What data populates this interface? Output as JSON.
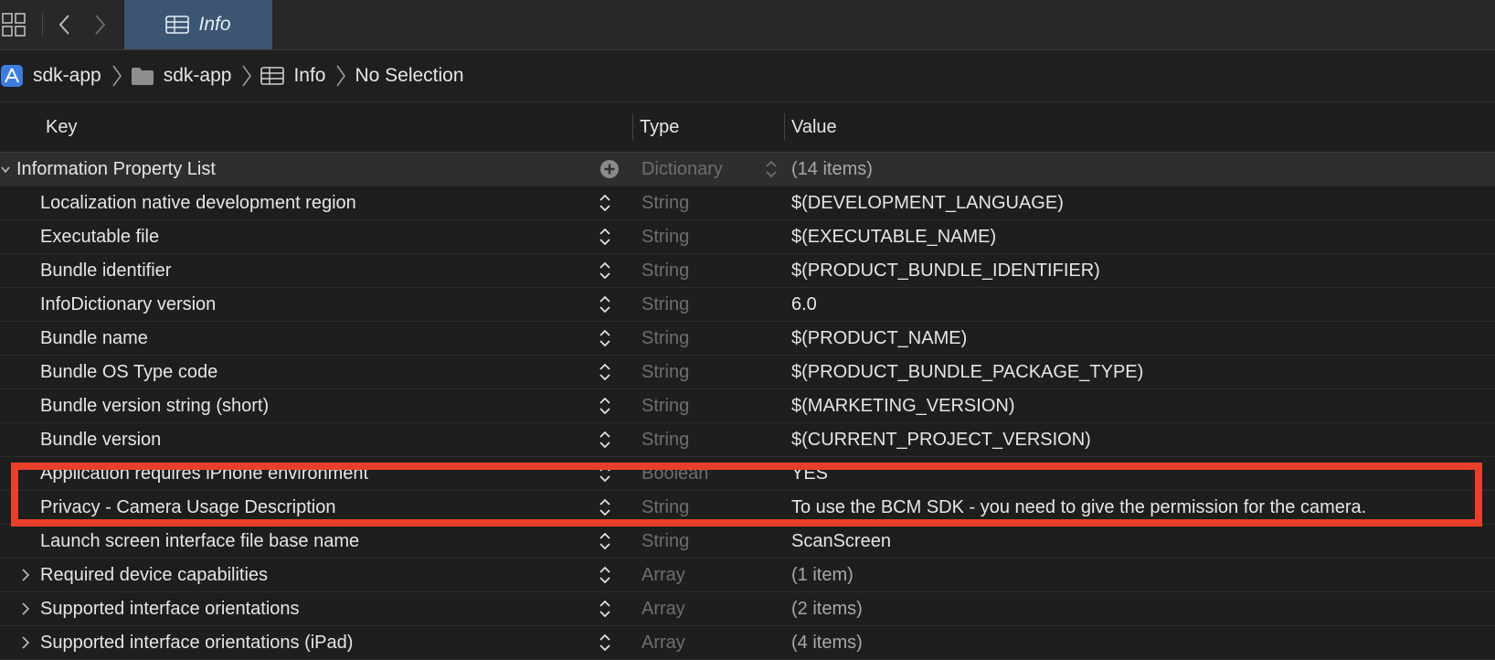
{
  "tab": {
    "label": "Info",
    "icon": "table-icon"
  },
  "breadcrumb": [
    {
      "label": "sdk-app",
      "icon": "app-project-icon"
    },
    {
      "label": "sdk-app",
      "icon": "folder-icon"
    },
    {
      "label": "Info",
      "icon": "table-icon"
    },
    {
      "label": "No Selection"
    }
  ],
  "columns": {
    "key": "Key",
    "type": "Type",
    "value": "Value"
  },
  "root": {
    "key": "Information Property List",
    "type": "Dictionary",
    "value": "(14 items)"
  },
  "rows": [
    {
      "key": "Localization native development region",
      "type": "String",
      "value": "$(DEVELOPMENT_LANGUAGE)"
    },
    {
      "key": "Executable file",
      "type": "String",
      "value": "$(EXECUTABLE_NAME)"
    },
    {
      "key": "Bundle identifier",
      "type": "String",
      "value": "$(PRODUCT_BUNDLE_IDENTIFIER)"
    },
    {
      "key": "InfoDictionary version",
      "type": "String",
      "value": "6.0"
    },
    {
      "key": "Bundle name",
      "type": "String",
      "value": "$(PRODUCT_NAME)"
    },
    {
      "key": "Bundle OS Type code",
      "type": "String",
      "value": "$(PRODUCT_BUNDLE_PACKAGE_TYPE)"
    },
    {
      "key": "Bundle version string (short)",
      "type": "String",
      "value": "$(MARKETING_VERSION)"
    },
    {
      "key": "Bundle version",
      "type": "String",
      "value": "$(CURRENT_PROJECT_VERSION)"
    },
    {
      "key": "Application requires iPhone environment",
      "type": "Boolean",
      "value": "YES"
    },
    {
      "key": "Privacy - Camera Usage Description",
      "type": "String",
      "value": "To use the BCM SDK - you need to give the permission for the camera."
    },
    {
      "key": "Launch screen interface file base name",
      "type": "String",
      "value": "ScanScreen"
    },
    {
      "key": "Required device capabilities",
      "type": "Array",
      "value": "(1 item)"
    },
    {
      "key": "Supported interface orientations",
      "type": "Array",
      "value": "(2 items)"
    },
    {
      "key": "Supported interface orientations (iPad)",
      "type": "Array",
      "value": "(4 items)"
    }
  ],
  "colors": {
    "highlight": "#e8402b",
    "tab_active": "#3b5573"
  }
}
